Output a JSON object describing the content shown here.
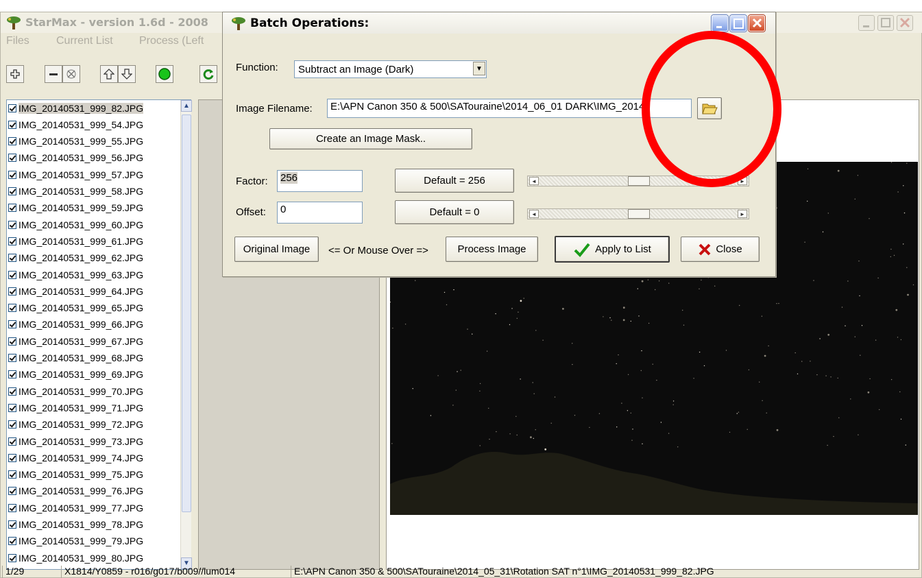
{
  "main_window": {
    "title": "StarMax - version 1.6d - 2008",
    "menu": [
      "Files",
      "Current List",
      "Process (Left"
    ]
  },
  "toolbar": {
    "buttons": [
      "add",
      "remove",
      "clear",
      "move-up",
      "move-down",
      "start",
      "refresh"
    ]
  },
  "file_list": [
    "IMG_20140531_999_82.JPG",
    "IMG_20140531_999_54.JPG",
    "IMG_20140531_999_55.JPG",
    "IMG_20140531_999_56.JPG",
    "IMG_20140531_999_57.JPG",
    "IMG_20140531_999_58.JPG",
    "IMG_20140531_999_59.JPG",
    "IMG_20140531_999_60.JPG",
    "IMG_20140531_999_61.JPG",
    "IMG_20140531_999_62.JPG",
    "IMG_20140531_999_63.JPG",
    "IMG_20140531_999_64.JPG",
    "IMG_20140531_999_65.JPG",
    "IMG_20140531_999_66.JPG",
    "IMG_20140531_999_67.JPG",
    "IMG_20140531_999_68.JPG",
    "IMG_20140531_999_69.JPG",
    "IMG_20140531_999_70.JPG",
    "IMG_20140531_999_71.JPG",
    "IMG_20140531_999_72.JPG",
    "IMG_20140531_999_73.JPG",
    "IMG_20140531_999_74.JPG",
    "IMG_20140531_999_75.JPG",
    "IMG_20140531_999_76.JPG",
    "IMG_20140531_999_77.JPG",
    "IMG_20140531_999_78.JPG",
    "IMG_20140531_999_79.JPG",
    "IMG_20140531_999_80.JPG"
  ],
  "status_bar": {
    "count": "1/29",
    "pixel_info": "X1814/Y0859 - r016/g017/b009//lum014",
    "path": "E:\\APN Canon 350 & 500\\SATouraine\\2014_05_31\\Rotation SAT n°1\\IMG_20140531_999_82.JPG"
  },
  "dialog": {
    "title": "Batch Operations:",
    "function_label": "Function:",
    "function_value": "Subtract an Image (Dark)",
    "filename_label": "Image Filename:",
    "filename_value": "E:\\APN Canon 350 & 500\\SATouraine\\2014_06_01 DARK\\IMG_2014",
    "mask_button": "Create an Image Mask..",
    "factor_label": "Factor:",
    "factor_value": "256",
    "factor_default": "Default = 256",
    "offset_label": "Offset:",
    "offset_value": "0",
    "offset_default": "Default = 0",
    "original_button": "Original Image",
    "mouse_hint": "<= Or Mouse Over =>",
    "process_button": "Process Image",
    "apply_button": "Apply to List",
    "close_button": "Close",
    "factor_slider_level": 0.5,
    "offset_slider_level": 0.5
  },
  "annotation": {
    "color": "#ff0000"
  }
}
